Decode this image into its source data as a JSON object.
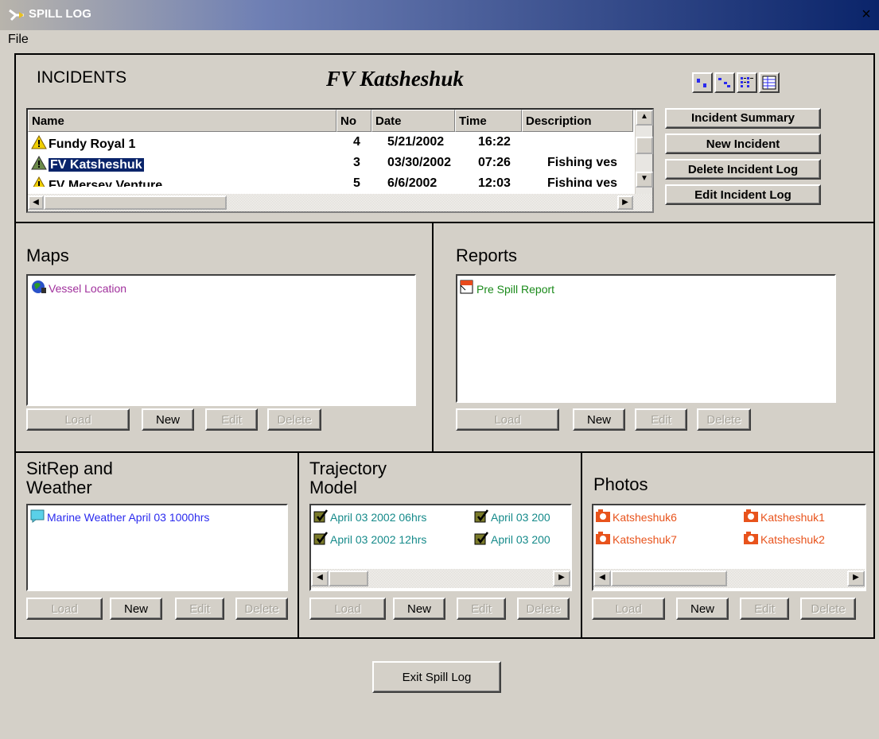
{
  "window": {
    "title": "SPILL LOG",
    "close": "×"
  },
  "menu": {
    "file": "File"
  },
  "incidents": {
    "heading": "INCIDENTS",
    "current_vessel": "FV Katsheshuk",
    "columns": [
      "Name",
      "No",
      "Date",
      "Time",
      "Description"
    ],
    "rows": [
      {
        "name": "Fundy Royal 1",
        "no": "4",
        "date": "5/21/2002",
        "time": "16:22",
        "description": ""
      },
      {
        "name": "FV Katsheshuk",
        "no": "3",
        "date": "03/30/2002",
        "time": "07:26",
        "description": "Fishing ves"
      },
      {
        "name": "FV Mersey Venture",
        "no": "5",
        "date": "6/6/2002",
        "time": "12:03",
        "description": "Fishing ves"
      }
    ],
    "buttons": {
      "summary": "Incident Summary",
      "new": "New Incident",
      "delete": "Delete Incident Log",
      "edit": "Edit Incident Log"
    }
  },
  "panels": {
    "maps": {
      "heading": "Maps",
      "items": [
        "Vessel Location"
      ]
    },
    "reports": {
      "heading": "Reports",
      "items": [
        "Pre Spill Report"
      ]
    },
    "sitrep": {
      "heading_line1": "SitRep and",
      "heading_line2": "Weather",
      "items": [
        "Marine Weather April 03 1000hrs"
      ]
    },
    "trajectory": {
      "heading_line1": "Trajectory",
      "heading_line2": "Model",
      "items": [
        "April 03 2002 06hrs",
        "April 03 200",
        "April 03 2002 12hrs",
        "April 03 200"
      ]
    },
    "photos": {
      "heading": "Photos",
      "items": [
        "Katsheshuk6",
        "Katsheshuk1",
        "Katsheshuk7",
        "Katsheshuk2"
      ]
    }
  },
  "actions": {
    "load": "Load",
    "new": "New",
    "edit": "Edit",
    "delete": "Delete"
  },
  "exit": "Exit Spill Log",
  "colors": {
    "maps_item": "#a0309c",
    "reports_item": "#1a8a1a",
    "sitrep_item": "#2a2aee",
    "trajectory_item": "#158a8a",
    "photos_item": "#e8531c",
    "selection": "#0a246a"
  }
}
